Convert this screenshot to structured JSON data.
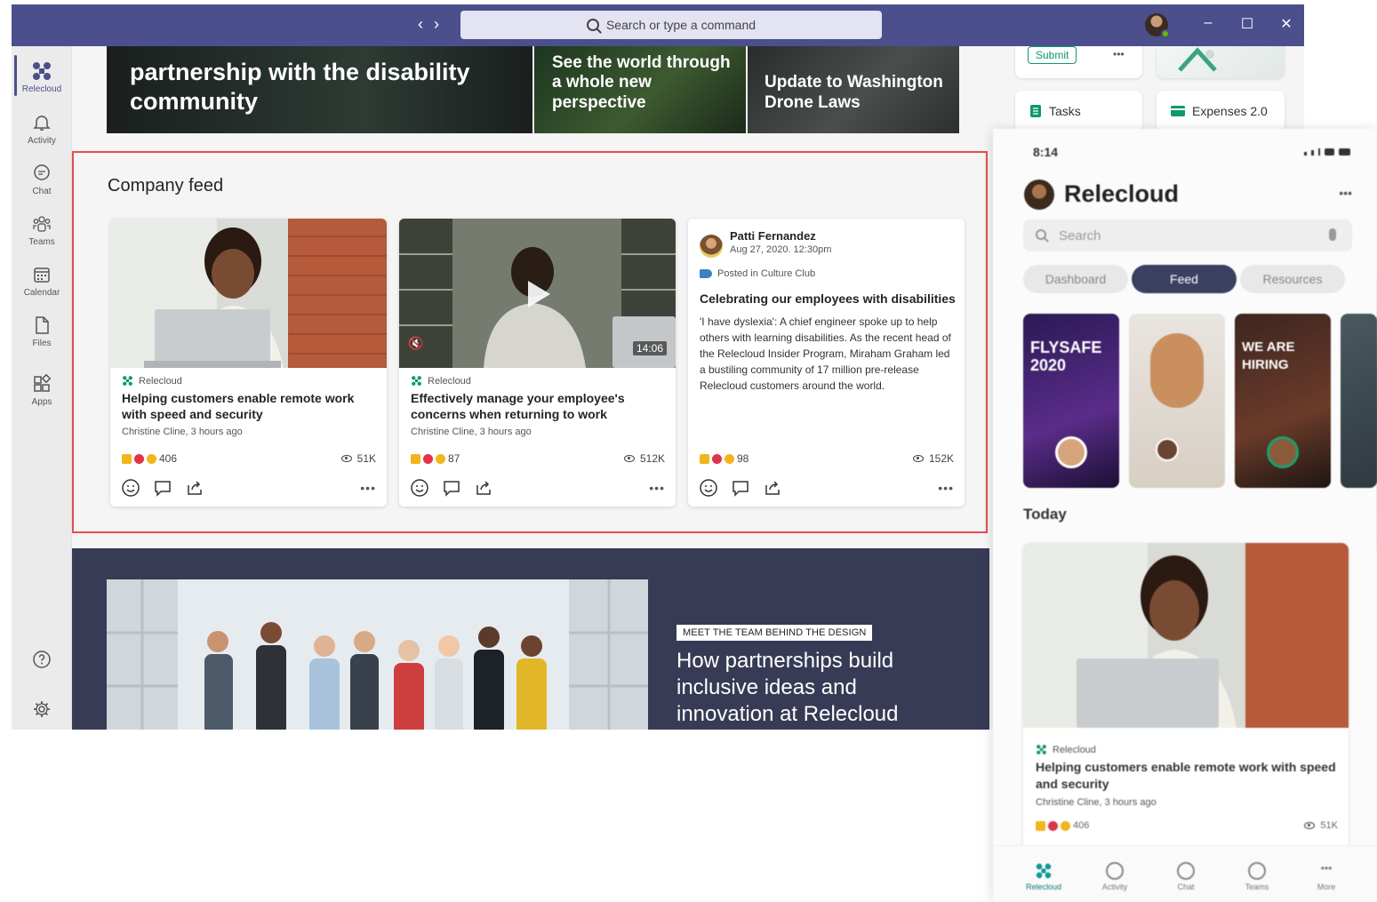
{
  "window": {
    "search_placeholder": "Search or type a command",
    "nav_back": "‹",
    "nav_forward": "›",
    "minimize": "–",
    "maximize": "☐",
    "close": "✕"
  },
  "rail": {
    "items": [
      {
        "label": "Relecloud",
        "icon": "relecloud-logo-icon"
      },
      {
        "label": "Activity",
        "icon": "bell-icon"
      },
      {
        "label": "Chat",
        "icon": "chat-icon"
      },
      {
        "label": "Teams",
        "icon": "teams-icon"
      },
      {
        "label": "Calendar",
        "icon": "calendar-icon"
      },
      {
        "label": "Files",
        "icon": "file-icon"
      },
      {
        "label": "Apps",
        "icon": "apps-icon"
      }
    ],
    "help_icon": "help-icon",
    "settings_icon": "gear-icon"
  },
  "hero": {
    "card1": "partnership with the disability community",
    "card2": "See the world through a whole new perspective",
    "card3": "Update to Washington Drone Laws"
  },
  "apps": {
    "submit": "Submit",
    "more": "•••",
    "tasks": "Tasks",
    "expenses": "Expenses 2.0"
  },
  "feed": {
    "title": "Company feed",
    "cards": [
      {
        "source": "Relecloud",
        "title": "Helping customers enable remote work with speed and security",
        "meta": "Christine Cline, 3 hours ago",
        "reactions": "406",
        "views": "51K"
      },
      {
        "source": "Relecloud",
        "title": "Effectively manage your employee's concerns when returning to work",
        "meta": "Christine Cline, 3 hours ago",
        "reactions": "87",
        "views": "512K",
        "duration": "14:06"
      },
      {
        "author": "Patti Fernandez",
        "date": "Aug 27, 2020. 12:30pm",
        "posted_in": "Posted in Culture Club",
        "title": "Celebrating our employees with disabilities",
        "body": "'I have dyslexia': A chief engineer spoke up to help others with learning disabilities. As the recent head of the Relecloud Insider Program, Miraham Graham led a bustiling community of 17 million pre-release Relecloud customers around the world.",
        "reactions": "98",
        "views": "152K"
      }
    ],
    "more": "•••"
  },
  "team": {
    "badge": "MEET THE TEAM BEHIND THE DESIGN",
    "headline": "How partnerships build inclusive ideas and innovation at Relecloud"
  },
  "phone": {
    "time": "8:14",
    "title": "Relecloud",
    "more": "•••",
    "search_placeholder": "Search",
    "tabs": [
      "Dashboard",
      "Feed",
      "Resources"
    ],
    "stories": [
      "FLYSAFE 2020",
      "",
      "WE ARE HIRING",
      ""
    ],
    "today": "Today",
    "card_source": "Relecloud",
    "card_title": "Helping customers enable remote work with speed and security",
    "card_meta": "Christine Cline, 3 hours ago",
    "card_reactions": "406",
    "card_views": "51K",
    "nav": [
      "Relecloud",
      "Activity",
      "Chat",
      "Teams",
      "More"
    ]
  },
  "colors": {
    "title_bar": "#4b4f8c",
    "highlight_border": "#e74c4c",
    "dark_band": "#383b55",
    "accent_green": "#0e9a6a"
  }
}
